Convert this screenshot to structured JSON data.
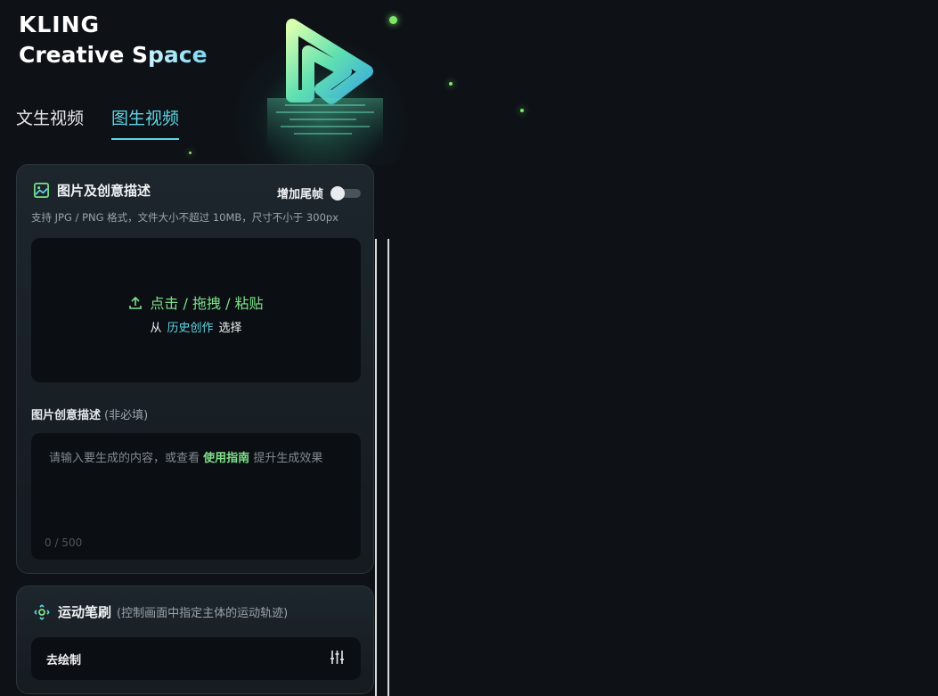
{
  "brand": {
    "line1": "KLING",
    "line2a": "Creative S",
    "line2b": "pace"
  },
  "tabs": [
    {
      "label": "文生视频",
      "active": false
    },
    {
      "label": "图生视频",
      "active": true
    }
  ],
  "image_panel": {
    "title": "图片及创意描述",
    "toggle_label": "增加尾帧",
    "toggle_on": false,
    "hint": "支持 JPG / PNG 格式，文件大小不超过 10MB，尺寸不小于 300px",
    "upload": {
      "action": "点击 / 拖拽 / 粘贴",
      "from": "从",
      "history_link": "历史创作",
      "select": "选择"
    },
    "desc_label": "图片创意描述",
    "desc_optional": "(非必填)",
    "placeholder_a": "请输入要生成的内容，或查看",
    "placeholder_link": "使用指南",
    "placeholder_b": "提升生成效果",
    "counter": "0 / 500"
  },
  "motion_panel": {
    "title": "运动笔刷",
    "subtitle": "(控制画面中指定主体的运动轨迹)",
    "draw_button": "去绘制"
  },
  "colors": {
    "accent": "#5fd6e6",
    "green": "#7fe08a",
    "bg": "#0e1116"
  }
}
